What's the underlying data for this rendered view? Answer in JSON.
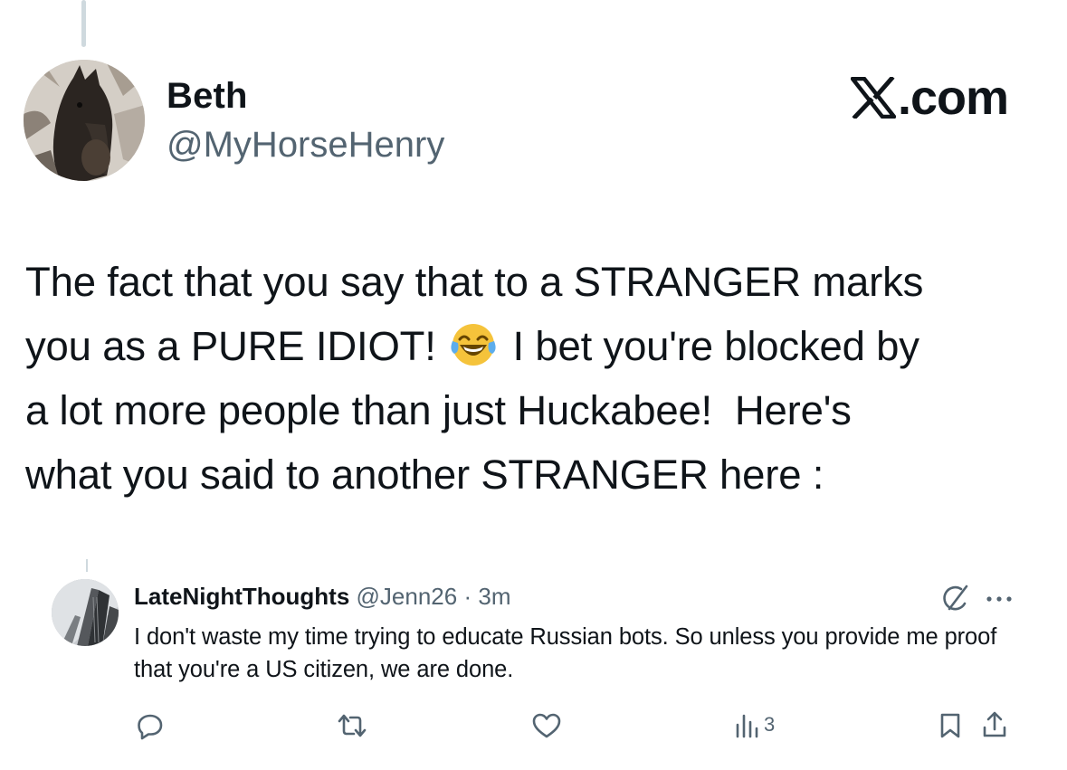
{
  "tweet": {
    "display_name": "Beth",
    "handle": "@MyHorseHenry",
    "brand_suffix": ".com",
    "text_part1": "The fact that you say that to a STRANGER marks\nyou as a PURE IDIOT! ",
    "emoji": "face-with-tears-of-joy",
    "text_part2": " I bet you're blocked by\na lot more people than just Huckabee!  Here's\nwhat you said to another STRANGER here :"
  },
  "quoted": {
    "display_name": "LateNightThoughts",
    "handle": "@Jenn26",
    "separator": "·",
    "time": "3m",
    "text": "I don't waste my time trying to educate Russian bots. So unless you provide me proof that you're a US citizen, we are done.",
    "views": "3"
  },
  "icons": {
    "reply": "reply-icon",
    "repost": "repost-icon",
    "like": "like-icon",
    "views": "views-icon",
    "bookmark": "bookmark-icon",
    "share": "share-icon",
    "grok": "grok-icon",
    "more": "more-icon"
  },
  "colors": {
    "text": "#0f1419",
    "secondary": "#536471",
    "thread_line": "#cfd9de"
  }
}
